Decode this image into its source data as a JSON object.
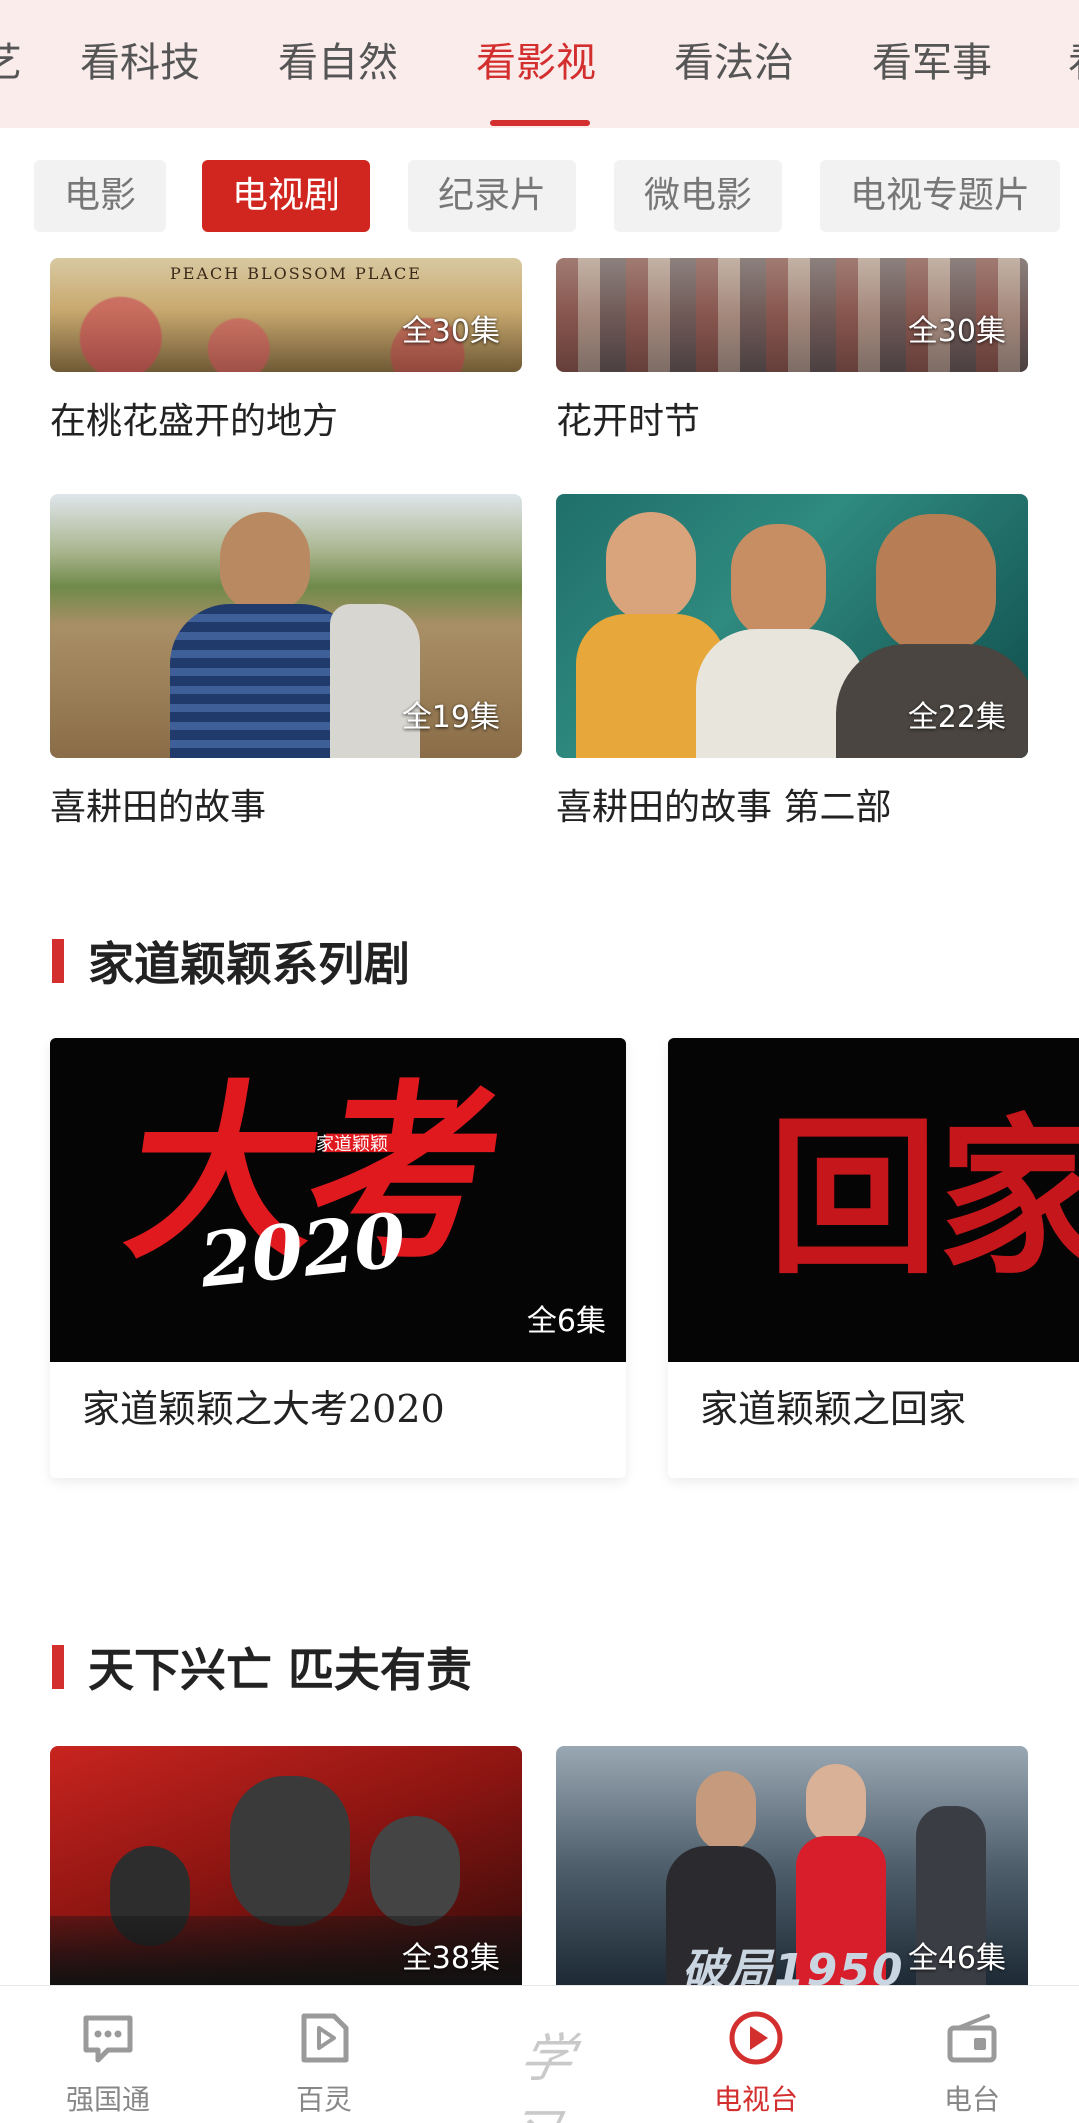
{
  "top_tabs": {
    "items": [
      "艺",
      "看科技",
      "看自然",
      "看影视",
      "看法治",
      "看军事",
      "看"
    ],
    "active": "看影视"
  },
  "sub_tabs": {
    "items": [
      "电影",
      "电视剧",
      "纪录片",
      "微电影",
      "电视专题片"
    ],
    "active": "电视剧"
  },
  "grid_top": [
    {
      "title": "在桃花盛开的地方",
      "episodes": "全30集",
      "poster_text": "PEACH BLOSSOM PLACE"
    },
    {
      "title": "花开时节",
      "episodes": "全30集"
    },
    {
      "title": "喜耕田的故事",
      "episodes": "全19集"
    },
    {
      "title": "喜耕田的故事 第二部",
      "episodes": "全22集"
    }
  ],
  "section_family": {
    "title": "家道颖颖系列剧",
    "cards": [
      {
        "title": "家道颖颖之大考2020",
        "episodes": "全6集",
        "poster_main": "大考",
        "poster_year": "2020",
        "poster_brand": "家道颖颖"
      },
      {
        "title": "家道颖颖之回家",
        "poster_main": "回家"
      }
    ]
  },
  "section_nation": {
    "title": "天下兴亡 匹夫有责",
    "items": [
      {
        "episodes": "全38集"
      },
      {
        "episodes": "全46集",
        "poster_text": "破局1950"
      }
    ]
  },
  "bottom_nav": {
    "items": [
      {
        "label": "强国通",
        "icon": "chat-icon"
      },
      {
        "label": "百灵",
        "icon": "play-square-icon"
      },
      {
        "label": "学习",
        "icon": "xuexi-logo"
      },
      {
        "label": "电视台",
        "icon": "play-circle-icon"
      },
      {
        "label": "电台",
        "icon": "radio-icon"
      }
    ],
    "active": "电视台"
  },
  "colors": {
    "accent": "#d32f2f",
    "top_bg": "#fbecec"
  }
}
